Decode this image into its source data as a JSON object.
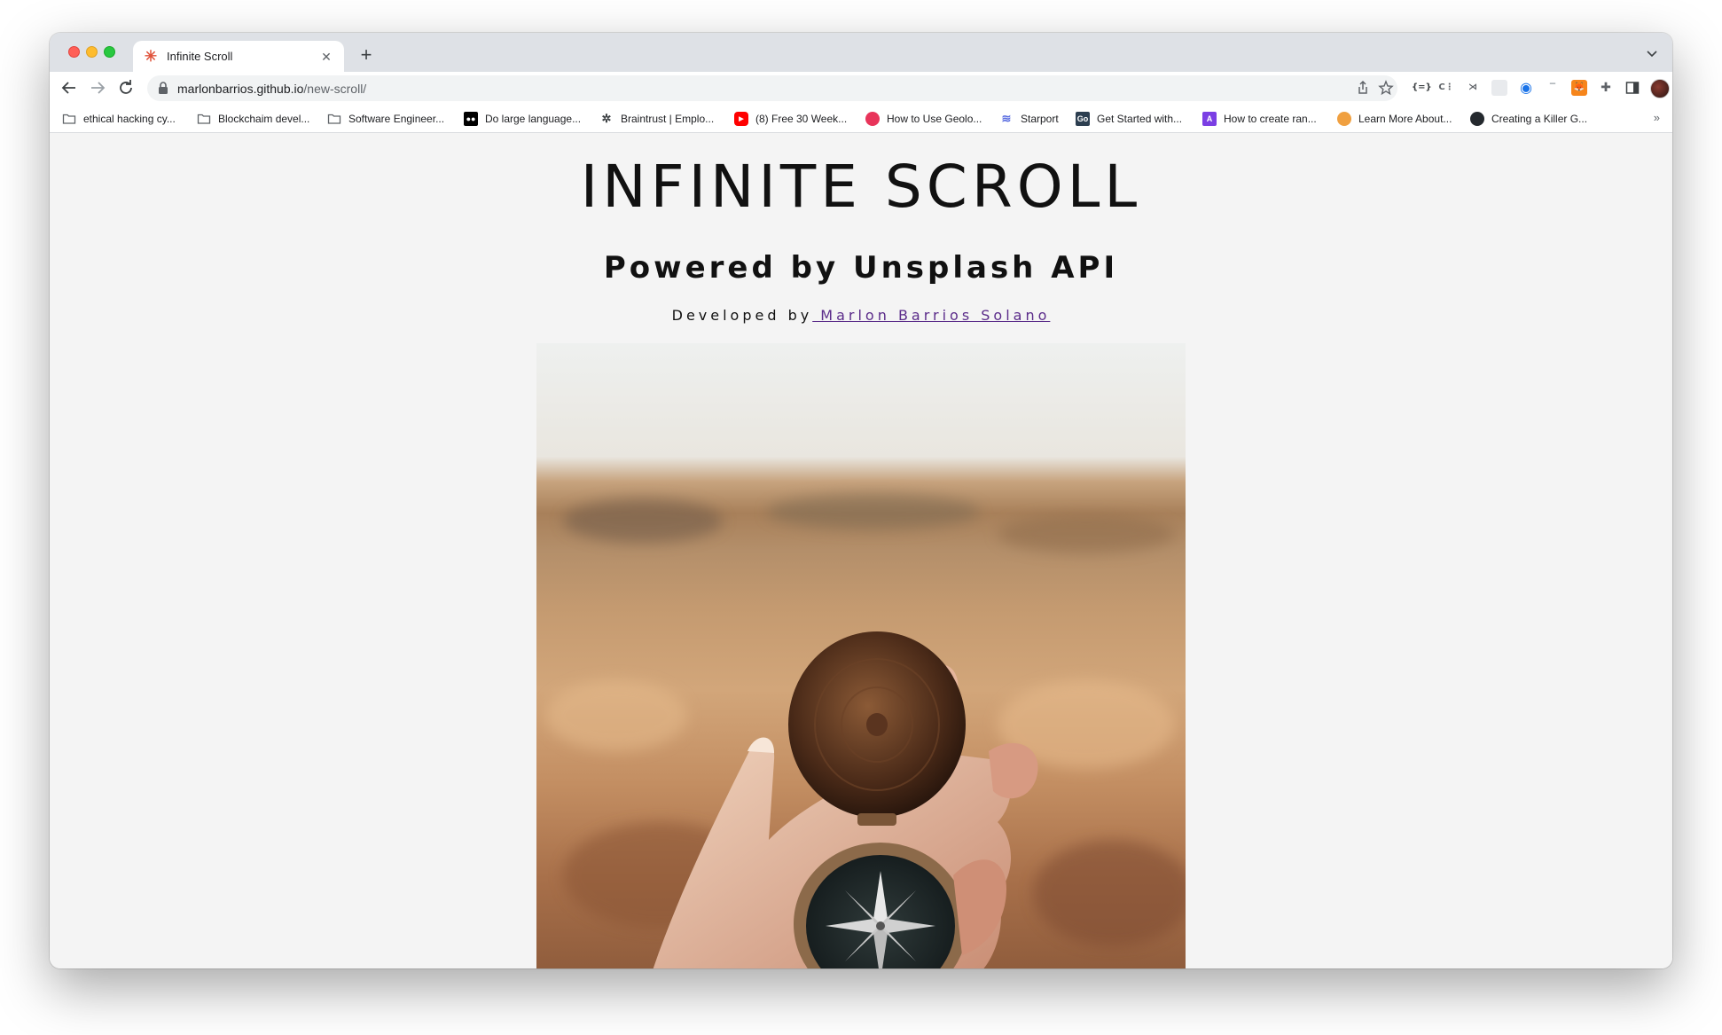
{
  "browser": {
    "tab": {
      "title": "Infinite Scroll"
    },
    "omnibox": {
      "domain": "marlonbarrios.github.io",
      "path": "/new-scroll/"
    },
    "bookmarks": [
      {
        "label": "ethical hacking cy...",
        "icon": "folder-icon"
      },
      {
        "label": "Blockchaim devel...",
        "icon": "folder-icon"
      },
      {
        "label": "Software Engineer...",
        "icon": "folder-icon"
      },
      {
        "label": "Do large language...",
        "icon": "medium-icon"
      },
      {
        "label": "Braintrust | Emplo...",
        "icon": "gear-icon"
      },
      {
        "label": "(8) Free 30 Week...",
        "icon": "youtube-icon"
      },
      {
        "label": "How to Use Geolo...",
        "icon": "pink-circle-icon"
      },
      {
        "label": "Starport",
        "icon": "starport-icon"
      },
      {
        "label": "Get Started with...",
        "icon": "go-icon"
      },
      {
        "label": "How to create ran...",
        "icon": "purple-a-icon"
      },
      {
        "label": "Learn More About...",
        "icon": "orange-circle-icon"
      },
      {
        "label": "Creating a Killer G...",
        "icon": "github-icon"
      }
    ],
    "more_label": "»"
  },
  "page": {
    "title": "INFINITE SCROLL",
    "subtitle": "Powered by Unsplash API",
    "credit_prefix": "Developed by",
    "credit_link": " Marlon Barrios Solano"
  },
  "colors": {
    "page_bg": "#f4f4f4",
    "link": "#5b2c8a",
    "tabstrip": "#dee1e6"
  }
}
